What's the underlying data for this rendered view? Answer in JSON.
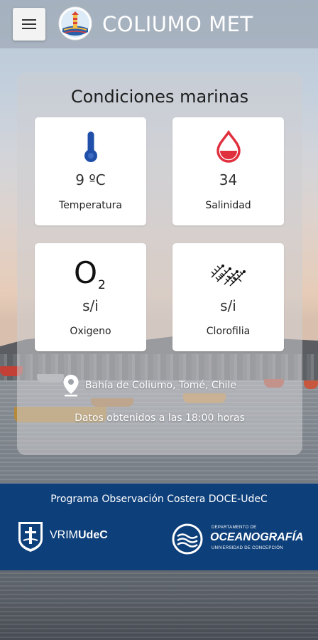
{
  "header": {
    "app_title": "COLIUMO MET",
    "menu_icon": "hamburger-menu-icon",
    "logo_icon": "lighthouse-logo-icon"
  },
  "panel": {
    "title": "Condiciones marinas",
    "tiles": [
      {
        "icon": "thermometer-icon",
        "value": "9 ºC",
        "label": "Temperatura",
        "color": "#1f4fa8"
      },
      {
        "icon": "water-drop-icon",
        "value": "34",
        "label": "Salinidad",
        "color": "#e0303e"
      },
      {
        "icon": "oxygen-o2-icon",
        "value": "s/i",
        "label": "Oxigeno",
        "color": "#111111"
      },
      {
        "icon": "plankton-icon",
        "value": "s/i",
        "label": "Clorofilia",
        "color": "#111111"
      }
    ],
    "location_icon": "location-pin-icon",
    "location": "Bahía de Coliumo, Tomé, Chile",
    "data_time": "Datos obtenidos a las 18:00 horas"
  },
  "footer": {
    "title": "Programa Observación Costera DOCE-UdeC",
    "vrim_prefix": "VRIM",
    "vrim_suffix": "UdeC",
    "ocean_top": "DEPARTAMENTO DE",
    "ocean_name": "OCEANOGRAFÍA",
    "ocean_bottom": "UNIVERSIDAD DE CONCEPCIÓN",
    "brand_color": "#0d3f7a"
  }
}
